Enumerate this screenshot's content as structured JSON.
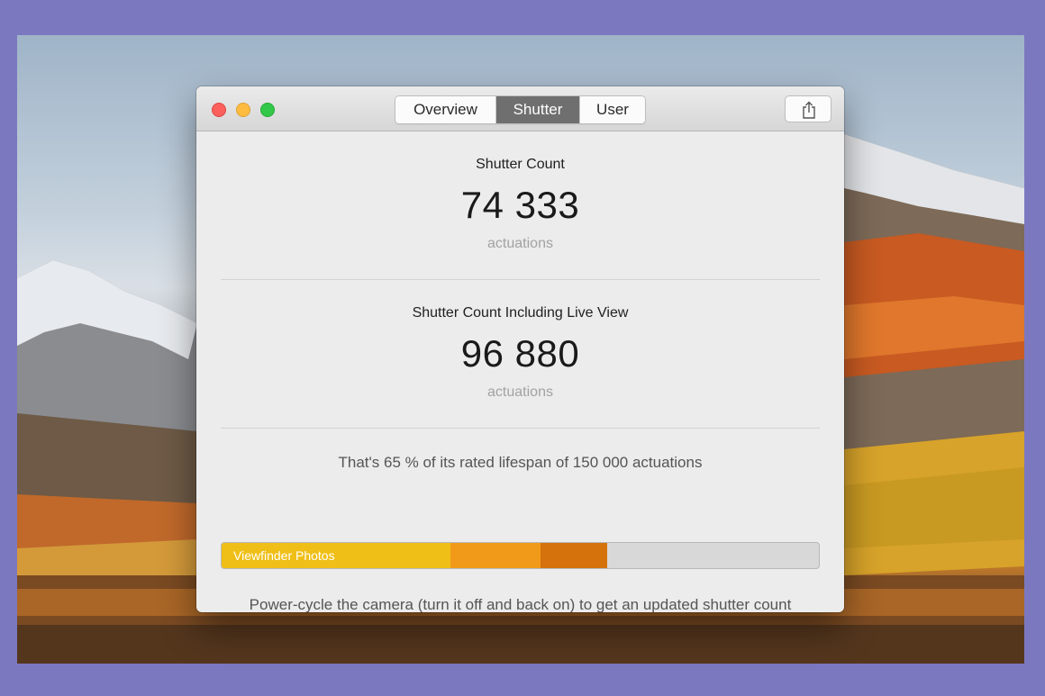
{
  "window": {
    "tabs": [
      {
        "label": "Overview",
        "selected": false
      },
      {
        "label": "Shutter",
        "selected": true
      },
      {
        "label": "User",
        "selected": false
      }
    ],
    "share_icon": "share-icon"
  },
  "shutter": {
    "title": "Shutter Count",
    "value": "74 333",
    "unit": "actuations"
  },
  "live_view": {
    "title": "Shutter Count Including Live View",
    "value": "96 880",
    "unit": "actuations"
  },
  "lifespan": {
    "text": "That's 65 % of its rated lifespan of 150 000 actuations",
    "percent": 65
  },
  "usage_bar": {
    "label": "Viewfinder Photos",
    "segments": [
      {
        "fraction": 0.3833,
        "color": "#f0bf17"
      },
      {
        "fraction": 0.1512,
        "color": "#f19a1a"
      },
      {
        "fraction": 0.1113,
        "color": "#d5720b"
      }
    ],
    "track_color": "#d8d8d8"
  },
  "note": "Power-cycle the camera (turn it off and back on) to get an updated shutter count reading.",
  "colors": {
    "background": "#7b78c0",
    "selected_tab": "#6f6f6f",
    "close": "#fc605c",
    "minimize": "#fdbc40",
    "maximize": "#34c84a"
  }
}
